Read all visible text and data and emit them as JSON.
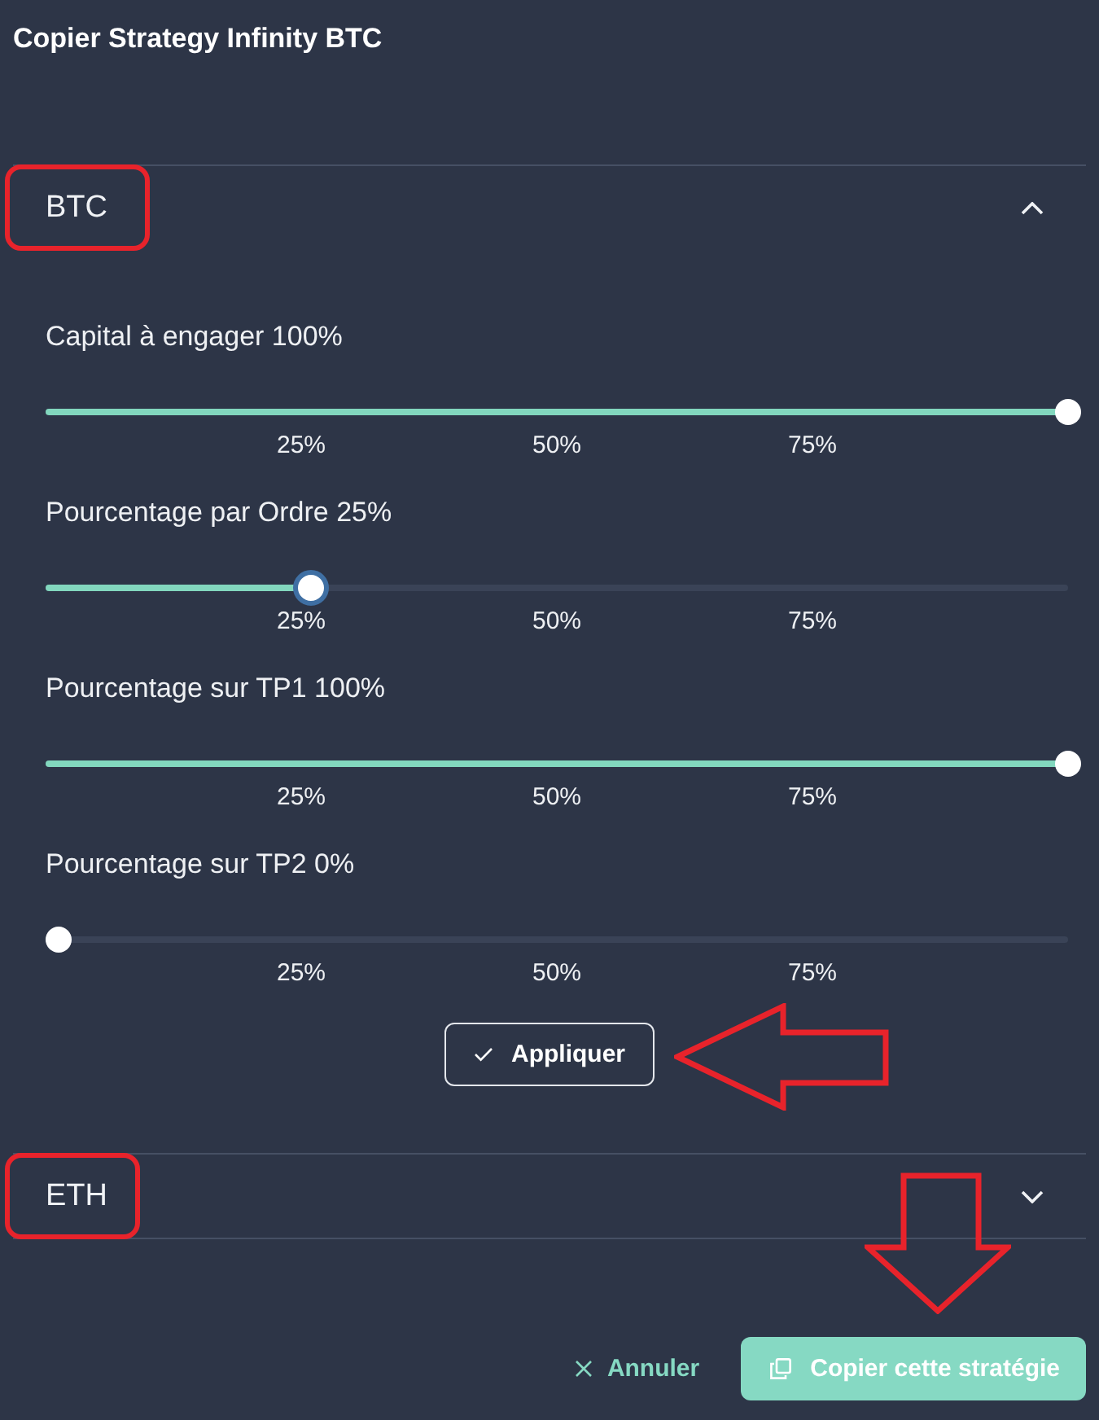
{
  "dialog": {
    "title": "Copier Strategy Infinity BTC"
  },
  "sections": [
    {
      "label": "BTC",
      "expanded": true,
      "highlighted": true,
      "sliders": [
        {
          "label": "Capital à engager 100%",
          "level": 1,
          "focused": false,
          "ticks": [
            "25%",
            "50%",
            "75%"
          ]
        },
        {
          "label": "Pourcentage par Ordre 25%",
          "level": 0.25,
          "focused": true,
          "ticks": [
            "25%",
            "50%",
            "75%"
          ]
        },
        {
          "label": "Pourcentage sur TP1 100%",
          "level": 1,
          "focused": false,
          "ticks": [
            "25%",
            "50%",
            "75%"
          ]
        },
        {
          "label": "Pourcentage sur TP2 0%",
          "level": 0,
          "focused": false,
          "ticks": [
            "25%",
            "50%",
            "75%"
          ]
        }
      ],
      "apply_button": {
        "label": "Appliquer",
        "pointed": true
      }
    },
    {
      "label": "ETH",
      "expanded": false,
      "highlighted": true
    }
  ],
  "footer": {
    "cancel_button": {
      "label": "Annuler"
    },
    "copy_button": {
      "label": "Copier cette stratégie",
      "pointed": true
    }
  }
}
